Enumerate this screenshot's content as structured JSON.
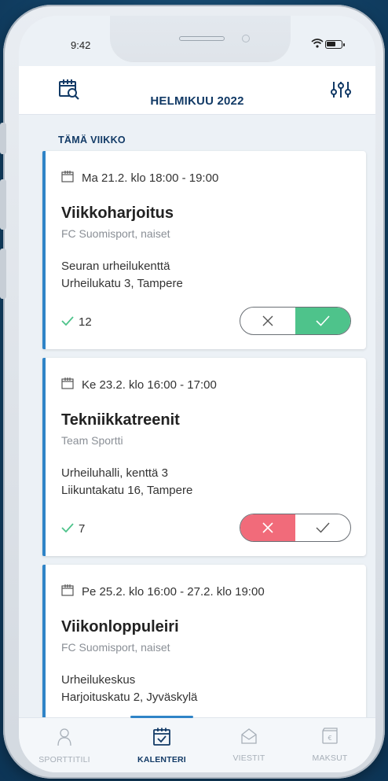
{
  "status_bar": {
    "time": "9:42"
  },
  "header": {
    "title": "HELMIKUU 2022",
    "left_icon": "calendar-search-icon",
    "right_icon": "filter-sliders-icon"
  },
  "section": {
    "title": "TÄMÄ VIIKKO"
  },
  "colors": {
    "primary_dark": "#123a66",
    "accent_blue": "#2f84c7",
    "accept_green": "#4ec38b",
    "decline_red": "#f16b7a"
  },
  "events": [
    {
      "date": "Ma 21.2. klo 18:00 - 19:00",
      "name": "Viikkoharjoitus",
      "org": "FC Suomisport, naiset",
      "location_name": "Seuran urheilukenttä",
      "address": "Urheilukatu 3, Tampere",
      "count": "12",
      "response": "yes"
    },
    {
      "date": "Ke 23.2. klo 16:00 - 17:00",
      "name": "Tekniikkatreenit",
      "org": "Team Sportti",
      "location_name": "Urheiluhalli, kenttä 3",
      "address": "Liikuntakatu 16, Tampere",
      "count": "7",
      "response": "no"
    },
    {
      "date": "Pe 25.2. klo 16:00 - 27.2. klo 19:00",
      "name": "Viikonloppuleiri",
      "org": "FC Suomisport, naiset",
      "location_name": "Urheilukeskus",
      "address": "Harjoituskatu 2, Jyväskylä"
    }
  ],
  "tabs": [
    {
      "label": "SPORTTITILI",
      "icon": "person-icon",
      "active": false
    },
    {
      "label": "KALENTERI",
      "icon": "calendar-check-icon",
      "active": true
    },
    {
      "label": "VIESTIT",
      "icon": "envelope-icon",
      "active": false
    },
    {
      "label": "MAKSUT",
      "icon": "wallet-icon",
      "active": false
    }
  ]
}
